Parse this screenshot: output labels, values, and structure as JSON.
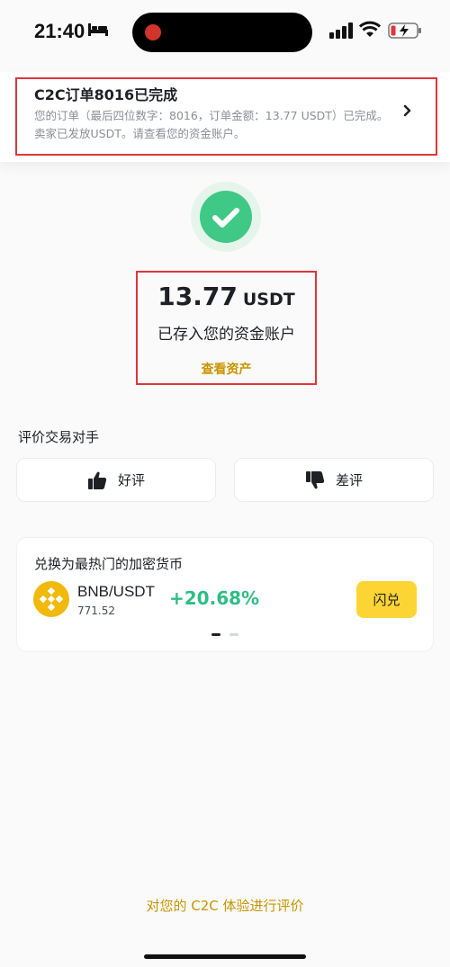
{
  "status_bar": {
    "time": "21:40",
    "icons": [
      "bed-icon",
      "signal-icon",
      "wifi-icon",
      "battery-charging-icon"
    ]
  },
  "notification": {
    "title": "C2C订单8016已完成",
    "body": "您的订单（最后四位数字：8016，订单金额：13.77 USDT）已完成。卖家已发放USDT。请查看您的资金账户。"
  },
  "result": {
    "amount": "13.77",
    "unit": "USDT",
    "message": "已存入您的资金账户",
    "view_assets": "查看资产"
  },
  "review": {
    "heading": "评价交易对手",
    "good": "好评",
    "bad": "差评"
  },
  "convert": {
    "title": "兑换为最热门的加密货币",
    "pair": "BNB/USDT",
    "price": "771.52",
    "change": "+20.68%",
    "button": "闪兑"
  },
  "footer": {
    "feedback": "对您的 C2C 体验进行评价"
  },
  "colors": {
    "accent_yellow": "#fcd535",
    "gold_text": "#c99400",
    "success_green": "#3fc886",
    "positive_change": "#2ebd85",
    "highlight_red": "#e0353c"
  }
}
